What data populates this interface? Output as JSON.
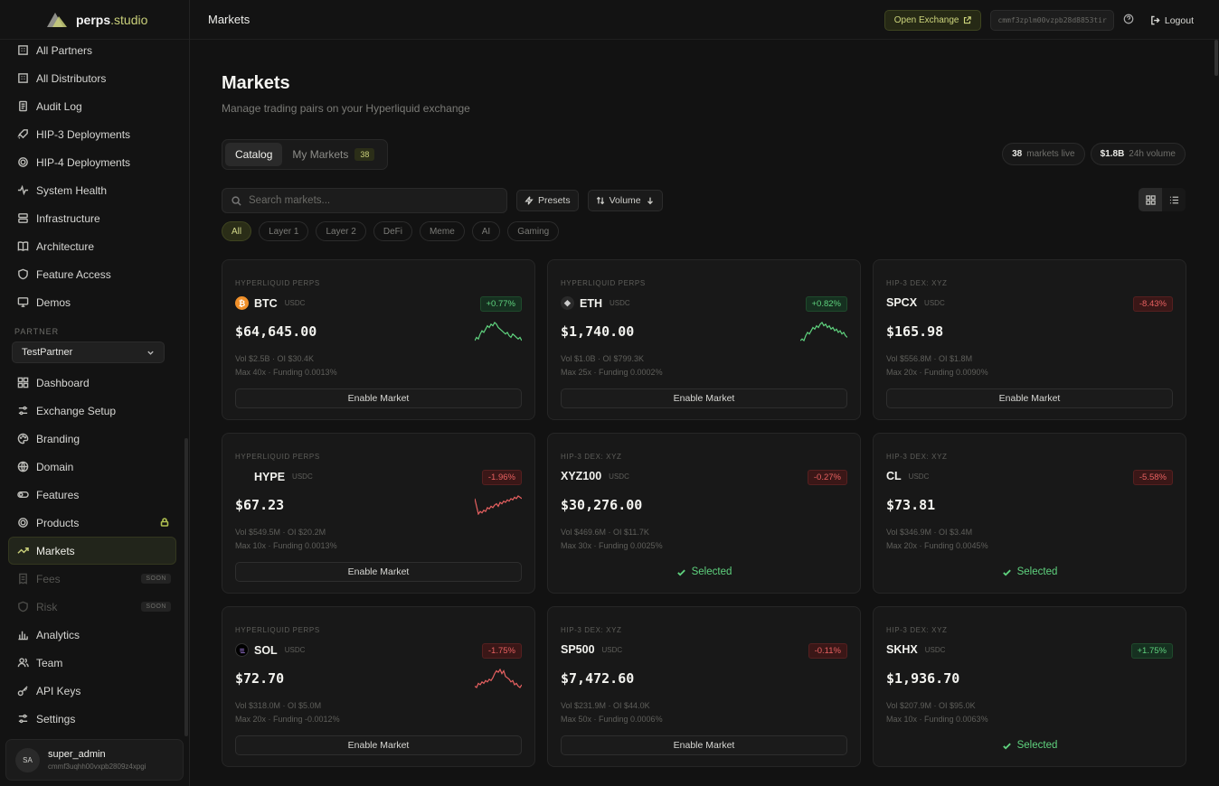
{
  "brand": {
    "name": "perps",
    "accent": ".studio"
  },
  "nav_top": [
    {
      "label": "All Partners",
      "icon": "building-icon"
    },
    {
      "label": "All Distributors",
      "icon": "building-icon"
    },
    {
      "label": "Audit Log",
      "icon": "scroll-icon"
    },
    {
      "label": "HIP-3 Deployments",
      "icon": "rocket-icon"
    },
    {
      "label": "HIP-4 Deployments",
      "icon": "target-icon"
    },
    {
      "label": "System Health",
      "icon": "pulse-icon"
    },
    {
      "label": "Infrastructure",
      "icon": "server-icon"
    },
    {
      "label": "Architecture",
      "icon": "book-icon"
    },
    {
      "label": "Feature Access",
      "icon": "shield-icon"
    },
    {
      "label": "Demos",
      "icon": "monitor-icon"
    }
  ],
  "partner": {
    "section_label": "PARTNER",
    "selected": "TestPartner"
  },
  "nav_partner": [
    {
      "label": "Dashboard",
      "icon": "grid-icon",
      "state": "normal"
    },
    {
      "label": "Exchange Setup",
      "icon": "sliders-icon",
      "state": "normal"
    },
    {
      "label": "Branding",
      "icon": "palette-icon",
      "state": "normal"
    },
    {
      "label": "Domain",
      "icon": "globe-icon",
      "state": "normal"
    },
    {
      "label": "Features",
      "icon": "toggle-icon",
      "state": "normal"
    },
    {
      "label": "Products",
      "icon": "target-icon",
      "state": "locked"
    },
    {
      "label": "Markets",
      "icon": "trend-icon",
      "state": "active"
    },
    {
      "label": "Fees",
      "icon": "receipt-icon",
      "state": "soon"
    },
    {
      "label": "Risk",
      "icon": "shield-icon",
      "state": "soon"
    },
    {
      "label": "Analytics",
      "icon": "bar-chart-icon",
      "state": "normal"
    },
    {
      "label": "Team",
      "icon": "users-icon",
      "state": "normal"
    },
    {
      "label": "API Keys",
      "icon": "key-icon",
      "state": "normal"
    },
    {
      "label": "Settings",
      "icon": "sliders-icon",
      "state": "normal"
    }
  ],
  "soon_label": "SOON",
  "user": {
    "initials": "SA",
    "name": "super_admin",
    "id": "cmmf3uqhh00vxpb2809z4xpgi"
  },
  "topbar": {
    "title": "Markets",
    "open_exchange": "Open Exchange",
    "client_id": "cmmf3zplm00vzpb28d8853tir",
    "logout": "Logout"
  },
  "page": {
    "title": "Markets",
    "subtitle": "Manage trading pairs on your Hyperliquid exchange"
  },
  "tabs": {
    "catalog": "Catalog",
    "my_markets": "My Markets",
    "my_markets_count": "38"
  },
  "stats": {
    "markets_value": "38",
    "markets_label": "markets live",
    "volume_value": "$1.8B",
    "volume_label": "24h volume"
  },
  "filters": {
    "search_placeholder": "Search markets...",
    "presets": "Presets",
    "sort": "Volume"
  },
  "categories": [
    "All",
    "Layer 1",
    "Layer 2",
    "DeFi",
    "Meme",
    "AI",
    "Gaming"
  ],
  "active_category": "All",
  "enable_label": "Enable Market",
  "selected_label": "Selected",
  "colors": {
    "accent": "#c9cf7a",
    "up": "#5fd27e",
    "down": "#e76060"
  },
  "markets": [
    {
      "dex": "HYPERLIQUID PERPS",
      "symbol": "BTC",
      "quote": "USDC",
      "coin": "btc",
      "change": "+0.77%",
      "dir": "up",
      "price": "$64,645.00",
      "vol": "Vol $2.5B",
      "oi": "OI $30.4K",
      "lev": "Max 40x",
      "funding": "Funding 0.0013%",
      "spark": [
        8,
        10,
        9,
        12,
        14,
        13,
        15,
        17,
        16,
        18,
        17,
        19,
        18,
        16,
        15,
        14,
        13,
        12,
        13,
        11,
        10,
        12,
        11,
        10,
        9,
        10,
        8
      ],
      "status": "enable"
    },
    {
      "dex": "HYPERLIQUID PERPS",
      "symbol": "ETH",
      "quote": "USDC",
      "coin": "eth",
      "change": "+0.82%",
      "dir": "up",
      "price": "$1,740.00",
      "vol": "Vol $1.0B",
      "oi": "OI $799.3K",
      "lev": "Max 25x",
      "funding": "Funding 0.0002%",
      "spark": [
        6,
        7,
        6,
        9,
        11,
        10,
        12,
        14,
        13,
        15,
        14,
        16,
        17,
        15,
        16,
        14,
        15,
        13,
        14,
        12,
        13,
        11,
        12,
        10,
        11,
        9,
        8
      ],
      "status": "enable"
    },
    {
      "dex": "HIP-3 DEX: XYZ",
      "symbol": "SPCX",
      "quote": "USDC",
      "coin": "",
      "change": "-8.43%",
      "dir": "down",
      "price": "$165.98",
      "vol": "Vol $556.8M",
      "oi": "OI $1.8M",
      "lev": "Max 20x",
      "funding": "Funding 0.0090%",
      "spark": [],
      "status": "enable"
    },
    {
      "dex": "HYPERLIQUID PERPS",
      "symbol": "HYPE",
      "quote": "USDC",
      "coin": "hype",
      "change": "-1.96%",
      "dir": "down",
      "price": "$67.23",
      "vol": "Vol $549.5M",
      "oi": "OI $20.2M",
      "lev": "Max 10x",
      "funding": "Funding 0.0013%",
      "spark": [
        16,
        10,
        4,
        6,
        5,
        7,
        6,
        9,
        8,
        10,
        9,
        11,
        12,
        10,
        13,
        12,
        14,
        13,
        15,
        14,
        16,
        15,
        17,
        16,
        18,
        17,
        16
      ],
      "status": "enable"
    },
    {
      "dex": "HIP-3 DEX: XYZ",
      "symbol": "XYZ100",
      "quote": "USDC",
      "coin": "",
      "change": "-0.27%",
      "dir": "down",
      "price": "$30,276.00",
      "vol": "Vol $469.6M",
      "oi": "OI $11.7K",
      "lev": "Max 30x",
      "funding": "Funding 0.0025%",
      "spark": [],
      "status": "selected"
    },
    {
      "dex": "HIP-3 DEX: XYZ",
      "symbol": "CL",
      "quote": "USDC",
      "coin": "",
      "change": "-5.58%",
      "dir": "down",
      "price": "$73.81",
      "vol": "Vol $346.9M",
      "oi": "OI $3.4M",
      "lev": "Max 20x",
      "funding": "Funding 0.0045%",
      "spark": [],
      "status": "selected"
    },
    {
      "dex": "HYPERLIQUID PERPS",
      "symbol": "SOL",
      "quote": "USDC",
      "coin": "sol",
      "change": "-1.75%",
      "dir": "down",
      "price": "$72.70",
      "vol": "Vol $318.0M",
      "oi": "OI $5.0M",
      "lev": "Max 20x",
      "funding": "Funding -0.0012%",
      "spark": [
        7,
        6,
        9,
        8,
        10,
        9,
        11,
        10,
        12,
        11,
        13,
        16,
        18,
        17,
        19,
        16,
        18,
        14,
        13,
        12,
        10,
        11,
        8,
        9,
        7,
        6,
        8
      ],
      "status": "enable"
    },
    {
      "dex": "HIP-3 DEX: XYZ",
      "symbol": "SP500",
      "quote": "USDC",
      "coin": "",
      "change": "-0.11%",
      "dir": "down",
      "price": "$7,472.60",
      "vol": "Vol $231.9M",
      "oi": "OI $44.0K",
      "lev": "Max 50x",
      "funding": "Funding 0.0006%",
      "spark": [],
      "status": "enable"
    },
    {
      "dex": "HIP-3 DEX: XYZ",
      "symbol": "SKHX",
      "quote": "USDC",
      "coin": "",
      "change": "+1.75%",
      "dir": "up",
      "price": "$1,936.70",
      "vol": "Vol $207.9M",
      "oi": "OI $95.0K",
      "lev": "Max 10x",
      "funding": "Funding 0.0063%",
      "spark": [],
      "status": "selected"
    }
  ]
}
